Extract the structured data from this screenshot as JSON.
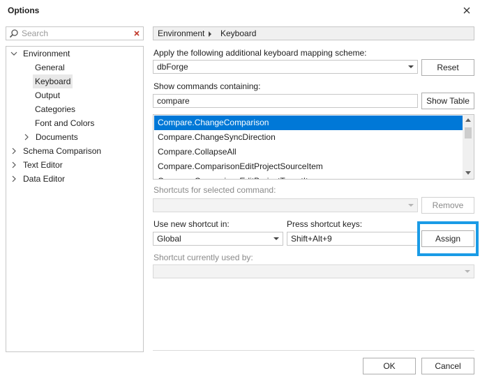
{
  "window": {
    "title": "Options"
  },
  "search": {
    "placeholder": "Search"
  },
  "tree": {
    "items": [
      {
        "label": "Environment",
        "expanded": true
      },
      {
        "label": "General"
      },
      {
        "label": "Keyboard",
        "selected": true
      },
      {
        "label": "Output"
      },
      {
        "label": "Categories"
      },
      {
        "label": "Font and Colors"
      },
      {
        "label": "Documents",
        "expandable": true
      },
      {
        "label": "Schema Comparison",
        "expandable": true
      },
      {
        "label": "Text Editor",
        "expandable": true
      },
      {
        "label": "Data Editor",
        "expandable": true
      }
    ]
  },
  "breadcrumb": {
    "parent": "Environment",
    "current": "Keyboard"
  },
  "mapping": {
    "label": "Apply the following additional keyboard mapping scheme:",
    "value": "dbForge",
    "reset_label": "Reset"
  },
  "commands": {
    "label": "Show commands containing:",
    "filter_value": "compare",
    "show_table_label": "Show Table",
    "items": [
      "Compare.ChangeComparison",
      "Compare.ChangeSyncDirection",
      "Compare.CollapseAll",
      "Compare.ComparisonEditProjectSourceItem",
      "Compare.ComparisonEditProjectTargetItem"
    ],
    "selected_index": 0
  },
  "shortcuts": {
    "label": "Shortcuts for selected command:",
    "value": "",
    "remove_label": "Remove"
  },
  "new_shortcut": {
    "scope_label": "Use new shortcut in:",
    "scope_value": "Global",
    "keys_label": "Press shortcut keys:",
    "keys_value": "Shift+Alt+9",
    "assign_label": "Assign"
  },
  "current_usage": {
    "label": "Shortcut currently used by:",
    "value": ""
  },
  "footer": {
    "ok_label": "OK",
    "cancel_label": "Cancel"
  },
  "colors": {
    "selection": "#0078d7",
    "highlight": "#1a9be6",
    "clear_icon": "#c0392b"
  },
  "icons": {
    "close": "close-icon",
    "search": "search-icon",
    "clear": "clear-icon"
  }
}
